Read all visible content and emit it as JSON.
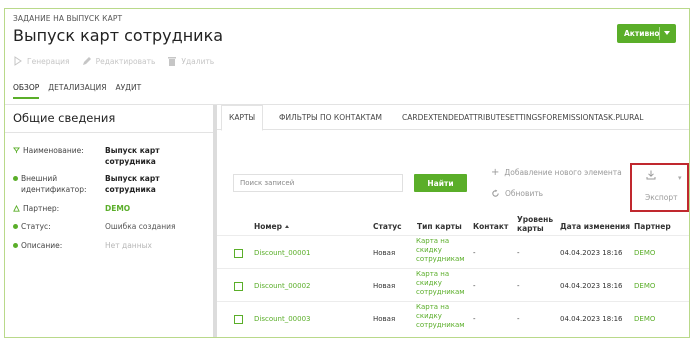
{
  "header": {
    "supertitle": "ЗАДАНИЕ НА ВЫПУСК КАРТ",
    "title": "Выпуск карт сотрудника",
    "status_label": "Активно"
  },
  "toolbar": {
    "generate": "Генерация",
    "edit": "Редактировать",
    "delete": "Удалить"
  },
  "tabs": [
    "ОБЗОР",
    "ДЕТАЛИЗАЦИЯ",
    "АУДИТ"
  ],
  "overview": {
    "heading": "Общие сведения",
    "props": [
      {
        "key": "Наименование:",
        "value": "Выпуск карт сотрудника"
      },
      {
        "key": "Внешний идентификатор:",
        "value": "Выпуск карт сотрудника"
      },
      {
        "key": "Партнер:",
        "value": "DEMO"
      },
      {
        "key": "Статус:",
        "value": "Ошибка создания"
      },
      {
        "key": "Описание:",
        "value": "Нет данных"
      }
    ]
  },
  "subtabs": [
    "КАРТЫ",
    "ФИЛЬТРЫ ПО КОНТАКТАМ",
    "CARDEXTENDEDATTRIBUTESETTINGSFOREMISSIONTASK.PLURAL"
  ],
  "search": {
    "placeholder": "Поиск записей",
    "button": "Найти"
  },
  "actions": {
    "add": "Добавление нового элемента",
    "refresh": "Обновить",
    "export": "Экспорт"
  },
  "table": {
    "columns": [
      "Номер",
      "Статус",
      "Тип карты",
      "Контакт",
      "Уровень карты",
      "Дата изменения",
      "Партнер"
    ],
    "rows": [
      {
        "number": "Discount_00001",
        "status": "Новая",
        "type": "Карта на скидку сотрудникам",
        "contact": "-",
        "level": "-",
        "date": "04.04.2023 18:16",
        "partner": "DEMO"
      },
      {
        "number": "Discount_00002",
        "status": "Новая",
        "type": "Карта на скидку сотрудникам",
        "contact": "-",
        "level": "-",
        "date": "04.04.2023 18:16",
        "partner": "DEMO"
      },
      {
        "number": "Discount_00003",
        "status": "Новая",
        "type": "Карта на скидку сотрудникам",
        "contact": "-",
        "level": "-",
        "date": "04.04.2023 18:16",
        "partner": "DEMO"
      }
    ]
  },
  "colors": {
    "accent": "#5aae29",
    "highlight": "#c0282e"
  }
}
